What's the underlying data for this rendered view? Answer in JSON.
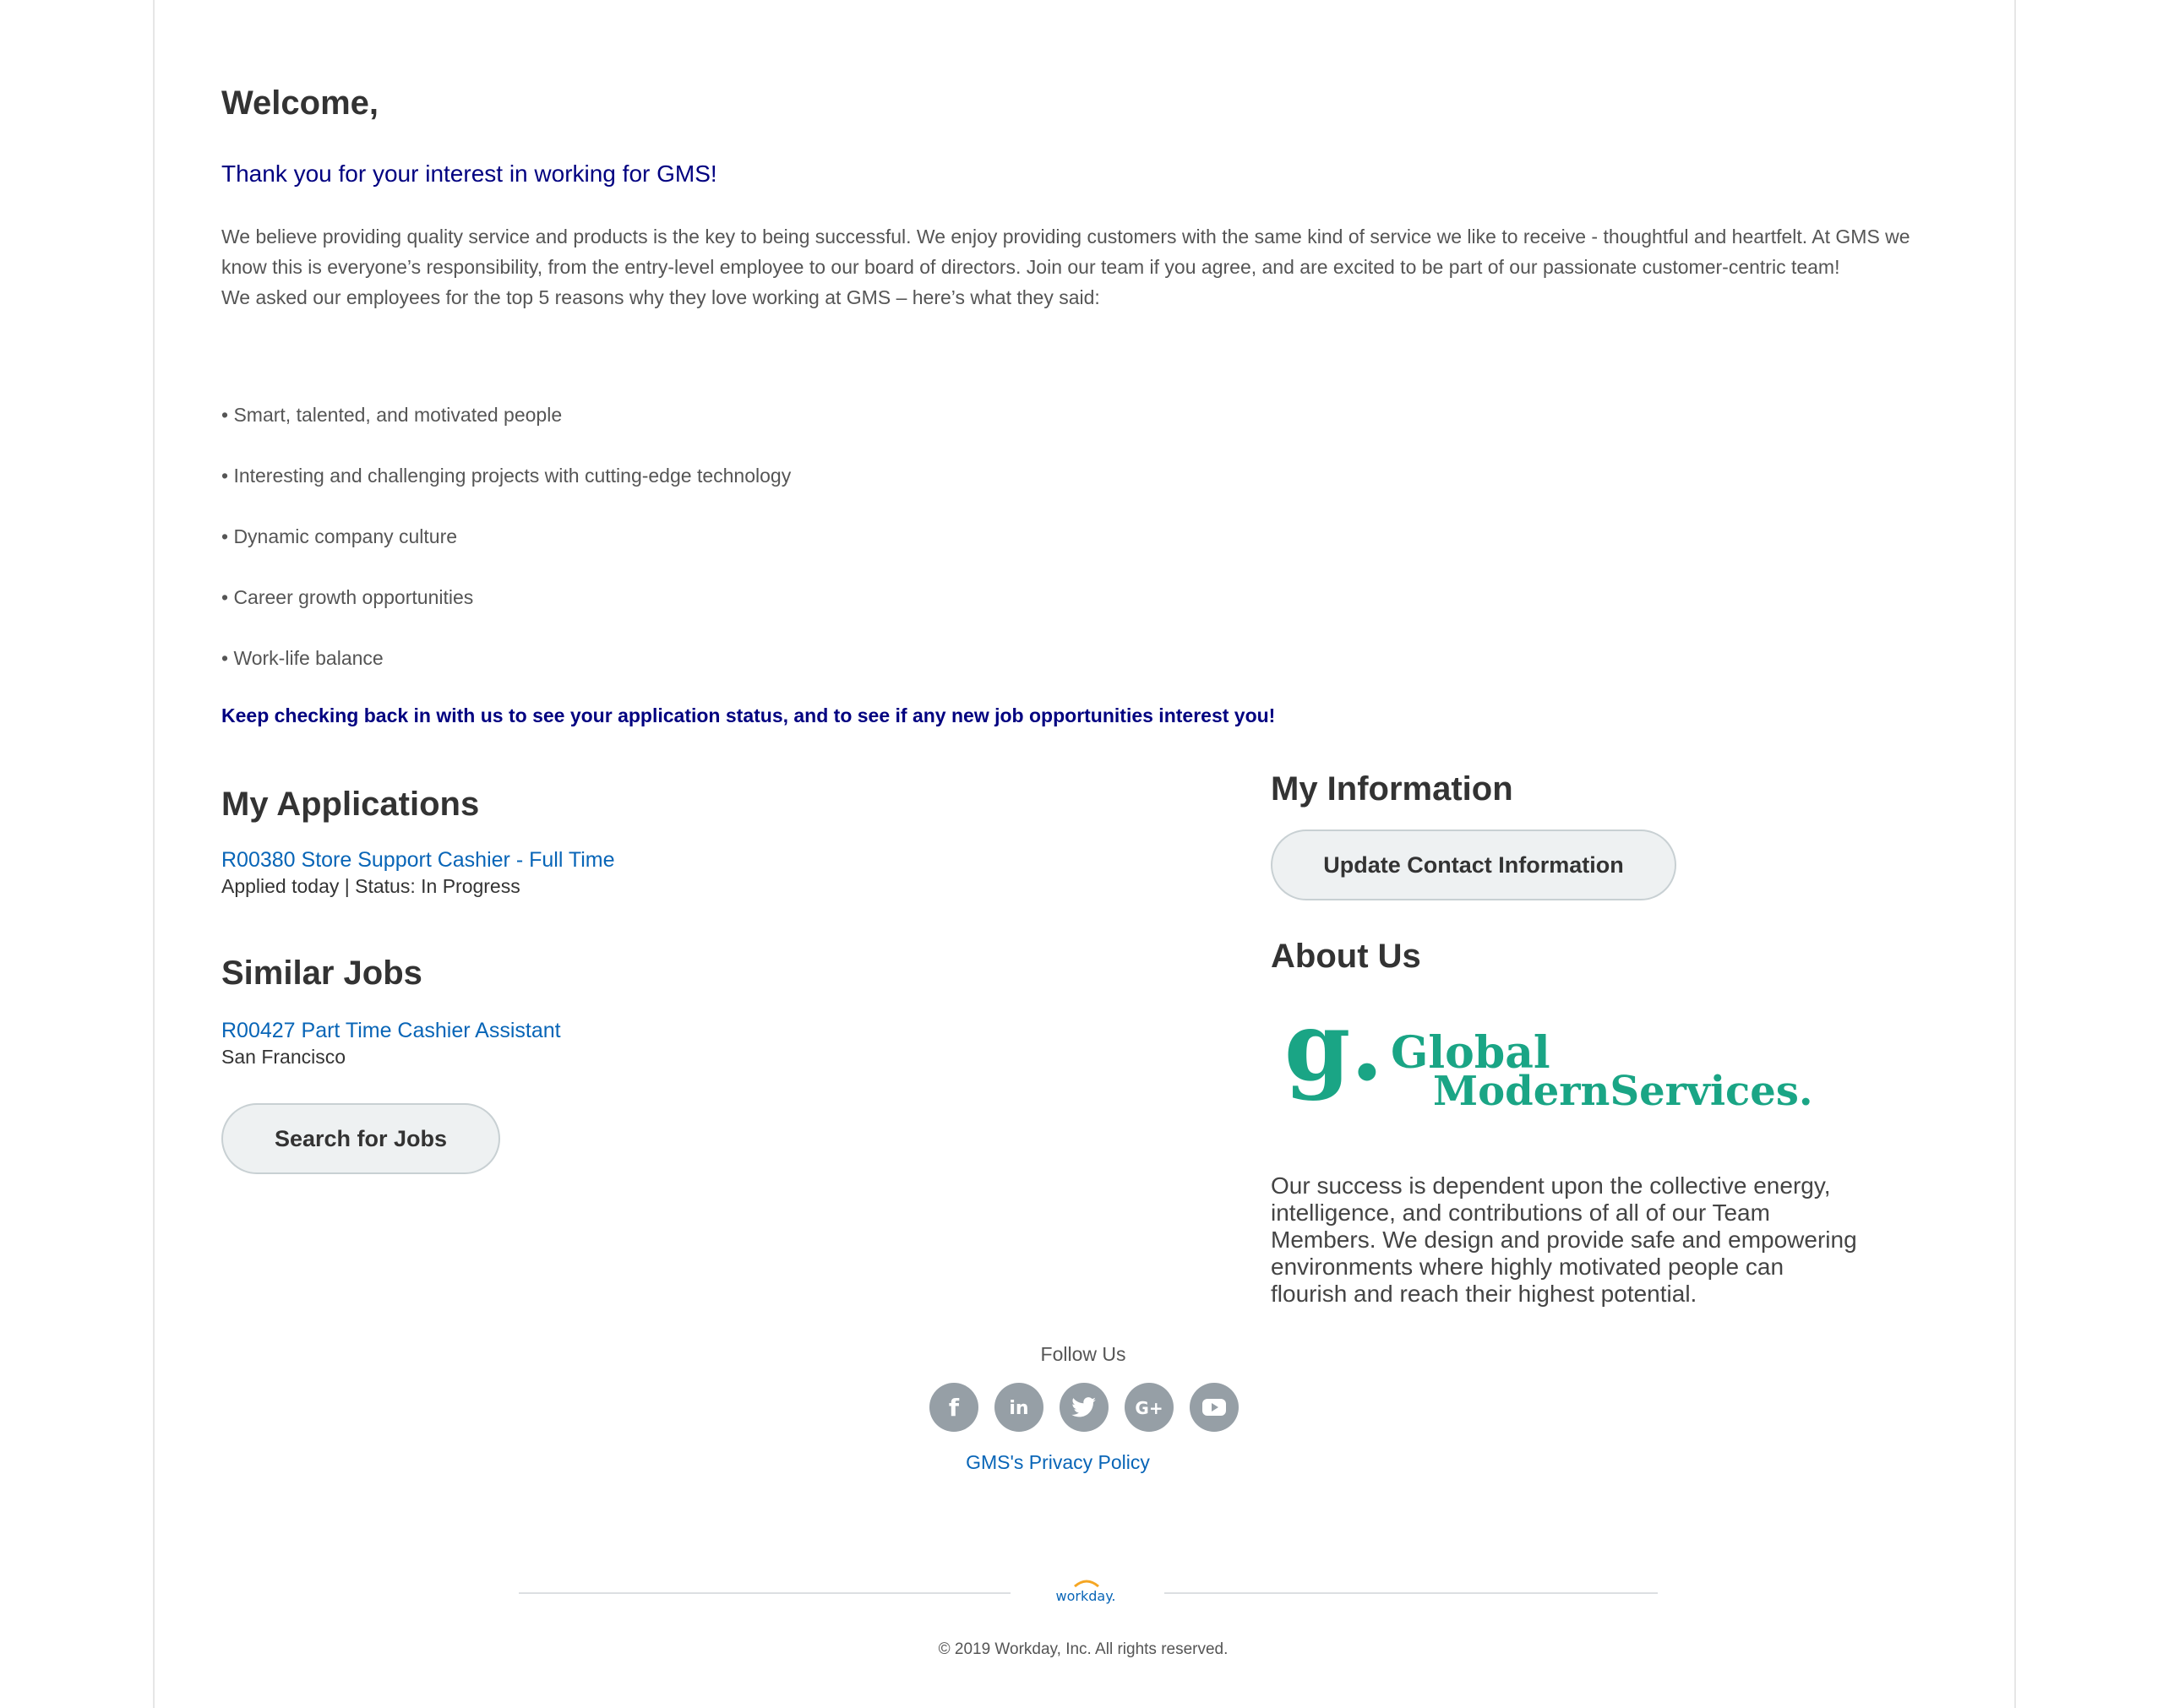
{
  "welcome": {
    "title": "Welcome,",
    "thanks": "Thank you for your interest in working for GMS!",
    "intro_1": "We believe providing quality service and products is the key to being successful.  We enjoy providing customers with the same kind of service we like to receive - thoughtful and heartfelt.  At GMS we know this is everyone’s responsibility, from the entry-level employee to our board of directors. Join our team if you agree, and are excited to be part of our passionate customer-centric team!",
    "intro_2": "We asked our employees for the top 5 reasons why they love working at GMS – here’s what they said:",
    "reasons": [
      "• Smart, talented, and motivated people",
      "• Interesting and challenging projects with cutting-edge technology",
      "• Dynamic company culture",
      "• Career growth opportunities",
      "• Work-life balance"
    ],
    "keep_checking": "Keep checking back in with us to see your application status, and to see if any new job opportunities interest you!"
  },
  "applications": {
    "title": "My Applications",
    "items": [
      {
        "link": "R00380 Store Support Cashier - Full Time",
        "status": "Applied today | Status: In Progress"
      }
    ]
  },
  "similar_jobs": {
    "title": "Similar Jobs",
    "items": [
      {
        "link": "R00427 Part Time Cashier Assistant",
        "location": "San Francisco"
      }
    ],
    "search_button": "Search for Jobs"
  },
  "my_information": {
    "title": "My Information",
    "update_button": "Update Contact Information"
  },
  "about": {
    "title": "About Us",
    "logo_mark": "g.",
    "logo_line1": "Global",
    "logo_line2": "ModernServices.",
    "text": "Our success is dependent upon the collective energy, intelligence, and contributions of all of our Team Members. We design and provide safe and empowering environments where highly motivated people can flourish and reach their highest potential."
  },
  "footer": {
    "follow_us": "Follow Us",
    "social": [
      {
        "icon": "facebook-icon",
        "glyph": "f"
      },
      {
        "icon": "linkedin-icon",
        "glyph": "in"
      },
      {
        "icon": "twitter-icon",
        "glyph": ""
      },
      {
        "icon": "google-plus-icon",
        "glyph": "G+"
      },
      {
        "icon": "youtube-icon",
        "glyph": ""
      }
    ],
    "privacy_link": "GMS's Privacy Policy",
    "workday_logo": "workday.",
    "copyright": "© 2019 Workday, Inc. All rights reserved."
  },
  "colors": {
    "heading": "#333333",
    "accent_navy": "#000080",
    "link_blue": "#0865b7",
    "brand_green": "#1aa585",
    "button_bg": "#eef1f2",
    "social_gray": "#969fa6",
    "workday_orange": "#f5a623"
  }
}
